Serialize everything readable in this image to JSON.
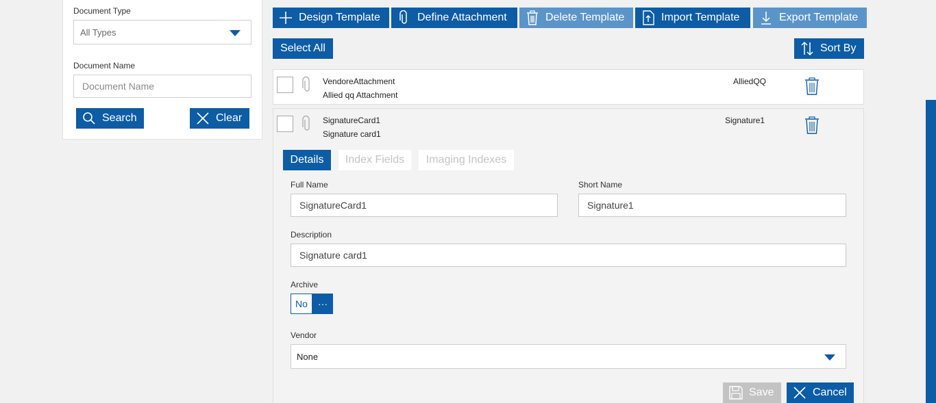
{
  "filters": {
    "document_type_label": "Document Type",
    "document_type_value": "All Types",
    "document_name_label": "Document Name",
    "document_name_placeholder": "Document Name",
    "search_label": "Search",
    "clear_label": "Clear"
  },
  "toolbar": {
    "design_template": "Design Template",
    "define_attachment": "Define Attachment",
    "delete_template": "Delete Template",
    "import_template": "Import Template",
    "export_template": "Export Template",
    "select_all": "Select All",
    "sort_by": "Sort By"
  },
  "templates": [
    {
      "full_name": "VendoreAttachment",
      "description": "Allied qq Attachment",
      "short_name": "AlliedQQ"
    },
    {
      "full_name": "SignatureCard1",
      "description": "Signature card1",
      "short_name": "Signature1"
    }
  ],
  "details": {
    "tabs": [
      "Details",
      "Index Fields",
      "Imaging Indexes"
    ],
    "full_name_label": "Full Name",
    "full_name_value": "SignatureCard1",
    "short_name_label": "Short Name",
    "short_name_value": "Signature1",
    "description_label": "Description",
    "description_value": "Signature card1",
    "archive_label": "Archive",
    "archive_value": "No",
    "archive_more": "···",
    "vendor_label": "Vendor",
    "vendor_value": "None",
    "save_label": "Save",
    "cancel_label": "Cancel"
  },
  "colors": {
    "accent": "#0d5ca6",
    "accent_light": "#5b94c9",
    "disabled": "#c3c3c3"
  }
}
